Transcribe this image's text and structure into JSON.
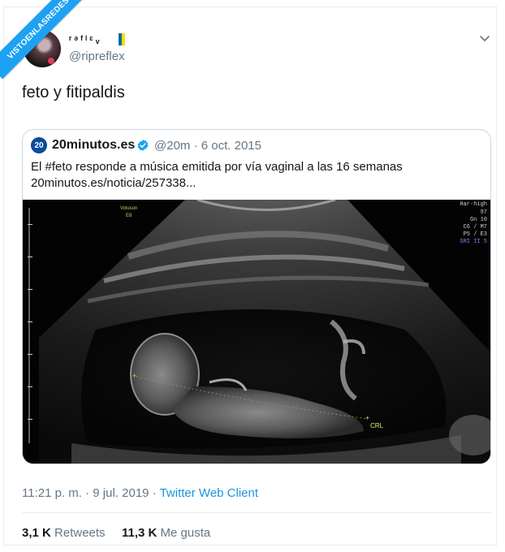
{
  "watermark": "VISTOENLASREDES",
  "author": {
    "display_name": "ʳᵊᶠˡᵋᵥ",
    "handle": "@ripreflex"
  },
  "tweet": {
    "text": "feto y fitipaldis"
  },
  "quoted": {
    "logo_text": "20",
    "name": "20minutos.es",
    "handle": "@20m",
    "separator": "·",
    "date": "6 oct. 2015",
    "line1": "El #feto responde a música emitida por vía vaginal a las 16 semanas",
    "line2": "20minutos.es/noticia/257338...",
    "image": {
      "label_left_1": "Voluson",
      "label_left_2": "E8",
      "readout": [
        "Har-high",
        "97",
        "Gn 10",
        "C6 / M7",
        "P5 / E3",
        "SRI II 5"
      ],
      "crl_label": "CRL"
    }
  },
  "meta": {
    "time": "11:21 p. m.",
    "dot": "·",
    "date": "9 jul. 2019",
    "client": "Twitter Web Client"
  },
  "stats": {
    "retweets_count": "3,1 K",
    "retweets_label": "Retweets",
    "likes_count": "11,3 K",
    "likes_label": "Me gusta"
  },
  "colors": {
    "accent": "#1da1f2",
    "link": "#1b95e0",
    "verified": "#1da1f2"
  },
  "icons": {
    "chevron": "chevron-down-icon",
    "verified": "verified-badge-icon",
    "flag": "canary-islands-flag-icon"
  }
}
